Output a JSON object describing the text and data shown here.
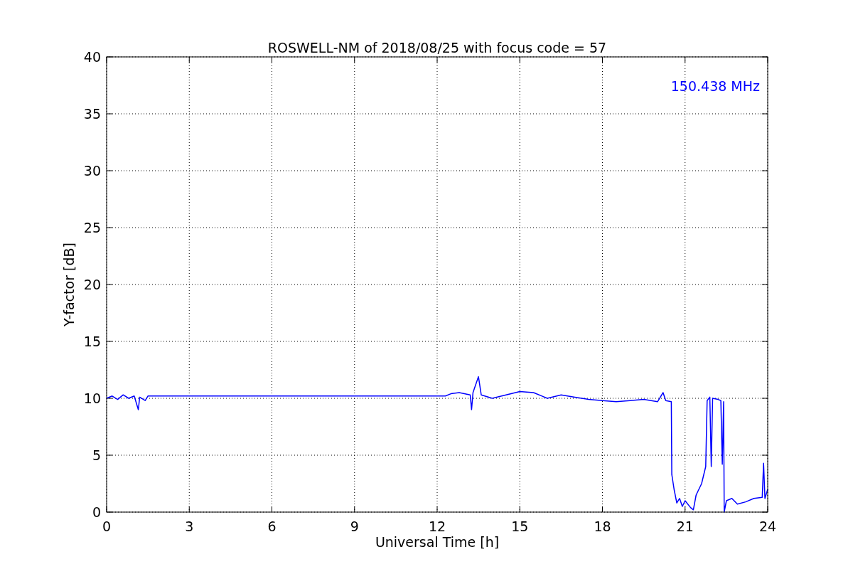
{
  "chart_data": {
    "type": "line",
    "title": "ROSWELL-NM of 2018/08/25 with focus code = 57",
    "xlabel": "Universal Time [h]",
    "ylabel": "Y-factor [dB]",
    "x": [
      0,
      0.2,
      0.4,
      0.6,
      0.8,
      1.0,
      1.15,
      1.2,
      1.4,
      1.5,
      12.3,
      12.5,
      12.8,
      13.2,
      13.25,
      13.3,
      13.5,
      13.6,
      14,
      14.5,
      15,
      15.5,
      16,
      16.5,
      17,
      17.5,
      18,
      18.5,
      19,
      19.5,
      20,
      20.2,
      20.3,
      20.5,
      20.52,
      20.6,
      20.7,
      20.8,
      20.9,
      21,
      21.2,
      21.3,
      21.4,
      21.6,
      21.75,
      21.8,
      21.9,
      21.95,
      22,
      22.2,
      22.3,
      22.35,
      22.4,
      22.42,
      22.5,
      22.7,
      22.9,
      23.2,
      23.5,
      23.8,
      23.85,
      23.9,
      24
    ],
    "series": [
      {
        "name": "150.438 MHz",
        "color": "#0000ff",
        "values": [
          10.0,
          10.2,
          9.9,
          10.3,
          10.0,
          10.2,
          9.0,
          10.1,
          9.8,
          10.2,
          10.2,
          10.4,
          10.5,
          10.3,
          9.0,
          10.5,
          11.9,
          10.3,
          10.0,
          10.3,
          10.6,
          10.5,
          10.0,
          10.3,
          10.1,
          9.9,
          9.8,
          9.7,
          9.8,
          9.9,
          9.7,
          10.5,
          9.8,
          9.7,
          3.3,
          2.0,
          0.8,
          1.2,
          0.5,
          1.0,
          0.4,
          0.2,
          1.5,
          2.5,
          4.0,
          9.8,
          10.1,
          4.0,
          10.0,
          9.9,
          9.8,
          4.2,
          9.7,
          0,
          1.0,
          1.2,
          0.7,
          0.9,
          1.2,
          1.3,
          4.3,
          1.2,
          2.0
        ]
      }
    ],
    "xlim": [
      0,
      24
    ],
    "ylim": [
      0,
      40
    ],
    "xticks": [
      0,
      3,
      6,
      9,
      12,
      15,
      18,
      21,
      24
    ],
    "yticks": [
      0,
      5,
      10,
      15,
      20,
      25,
      30,
      35,
      40
    ],
    "grid": true
  }
}
